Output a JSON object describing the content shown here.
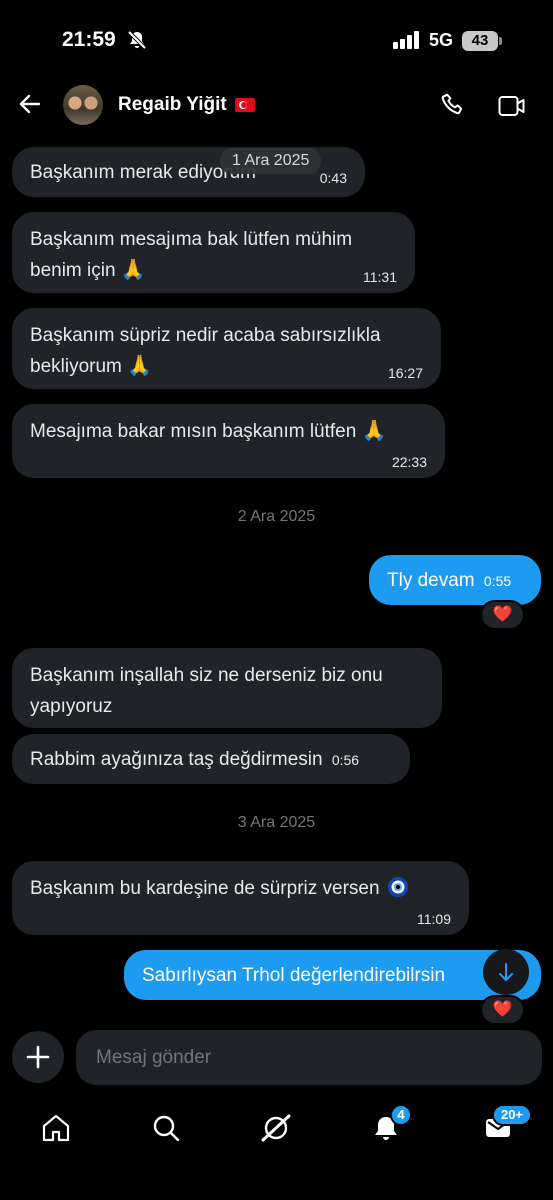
{
  "status_bar": {
    "time": "21:59",
    "network": "5G",
    "battery": "43"
  },
  "header": {
    "contact_name": "Regaib Yiğit"
  },
  "floating_date": "1 Ara 2025",
  "messages": [
    {
      "direction": "in",
      "text": "Başkanım merak ediyorum",
      "time": "0:43"
    },
    {
      "direction": "in",
      "line1": "Başkanım mesajıma bak lütfen mühim",
      "line2": "benim için",
      "time": "11:31"
    },
    {
      "direction": "in",
      "line1": "Başkanım süpriz nedir acaba sabırsızlıkla",
      "line2": "bekliyorum",
      "time": "16:27"
    },
    {
      "direction": "in",
      "text": "Mesajıma bakar mısın başkanım lütfen",
      "time": "22:33"
    },
    {
      "direction": "out",
      "text": "Tly devam",
      "time": "0:55",
      "reaction": "❤️"
    },
    {
      "direction": "in",
      "line1": "Başkanım inşallah siz ne derseniz biz onu",
      "line2": "yapıyoruz"
    },
    {
      "direction": "in",
      "text": "Rabbim ayağınıza taş değdirmesin",
      "time": "0:56"
    },
    {
      "direction": "in",
      "text": "Başkanım bu kardeşine de sürpriz versen",
      "time": "11:09"
    },
    {
      "direction": "out",
      "text": "Sabırlıysan Trhol değerlendirebilrsin",
      "reaction": "❤️"
    }
  ],
  "date_separators": [
    "2 Ara 2025",
    "3 Ara 2025"
  ],
  "composer": {
    "placeholder": "Mesaj gönder"
  },
  "nav": {
    "items": [
      "home-icon",
      "search-icon",
      "grok-icon",
      "notifications-icon",
      "messages-icon"
    ],
    "notifications_badge": "4",
    "messages_badge": "20+"
  },
  "colors": {
    "accent": "#1d9bf0",
    "bubble_in": "#202327",
    "background": "#000000"
  }
}
